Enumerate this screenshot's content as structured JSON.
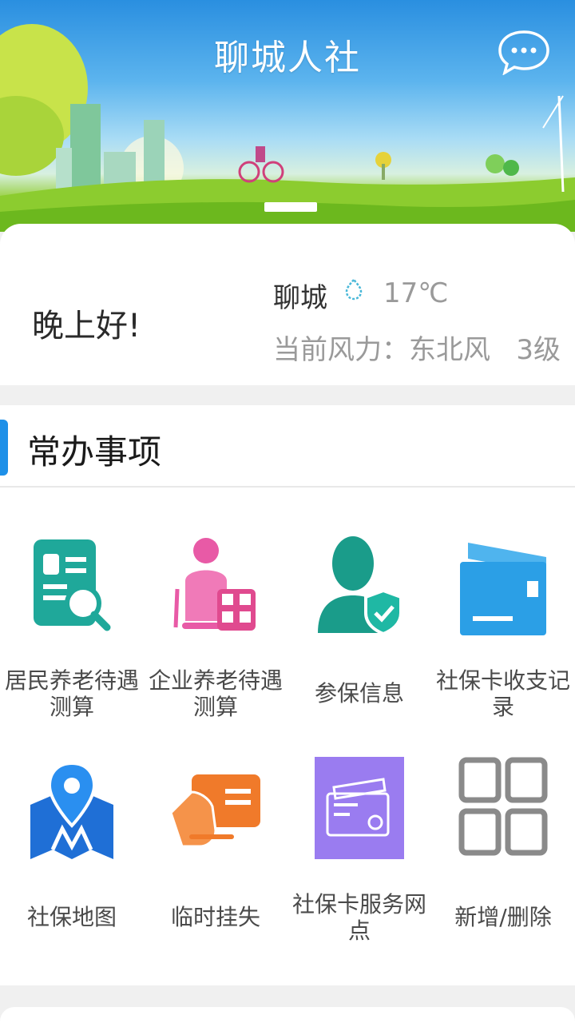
{
  "app": {
    "title": "聊城人社"
  },
  "greeting": "晚上好!",
  "weather": {
    "city": "聊城",
    "temperature": "17℃",
    "wind": "当前风力：东北风   3级",
    "icon": "rain-drop-icon"
  },
  "section": {
    "title": "常办事项"
  },
  "services": [
    {
      "id": "resident-pension",
      "label_l1": "居民养老待遇",
      "label_l2": "测算",
      "icon": "document-search-icon",
      "color": "#1fa89a"
    },
    {
      "id": "enterprise-pension",
      "label_l1": "企业养老待遇",
      "label_l2": "测算",
      "icon": "elder-calculator-icon",
      "color": "#e85aa6"
    },
    {
      "id": "insured-info",
      "label_l1": "参保信息",
      "label_l2": "",
      "icon": "person-shield-icon",
      "color": "#1a9c8a"
    },
    {
      "id": "card-records",
      "label_l1": "社保卡收支记",
      "label_l2": "录",
      "icon": "card-icon",
      "color": "#2b9fe6"
    },
    {
      "id": "ss-map",
      "label_l1": "社保地图",
      "label_l2": "",
      "icon": "map-pin-icon",
      "color": "#1f6fd6"
    },
    {
      "id": "temp-loss",
      "label_l1": "临时挂失",
      "label_l2": "",
      "icon": "hand-card-icon",
      "color": "#f07a2a"
    },
    {
      "id": "service-points",
      "label_l1": "社保卡服务网",
      "label_l2": "点",
      "icon": "purple-card-icon",
      "color": "#9a7cf0"
    },
    {
      "id": "add-remove",
      "label_l1": "新增/删除",
      "label_l2": "",
      "icon": "grid-icon",
      "color": "#888888"
    }
  ]
}
